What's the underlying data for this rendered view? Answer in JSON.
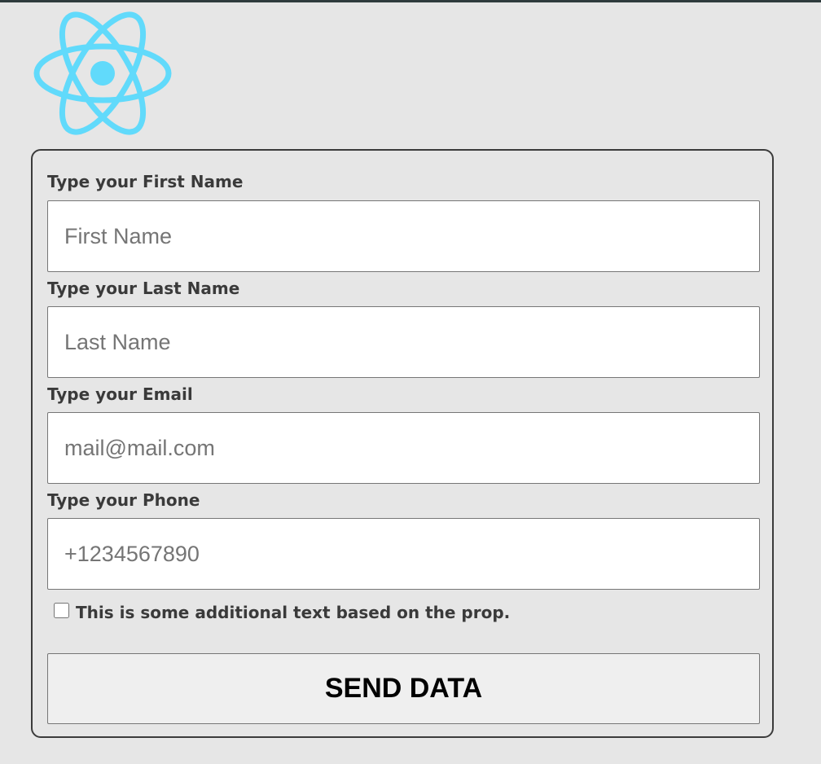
{
  "header": {
    "logo_icon": "react-atom-icon",
    "logo_color": "#61dafb",
    "top_bar_color": "#2f3b3d"
  },
  "form": {
    "first_name": {
      "label": "Type your First Name",
      "placeholder": "First Name",
      "value": ""
    },
    "last_name": {
      "label": "Type your Last Name",
      "placeholder": "Last Name",
      "value": ""
    },
    "email": {
      "label": "Type your Email",
      "placeholder": "mail@mail.com",
      "value": ""
    },
    "phone": {
      "label": "Type your Phone",
      "placeholder": "+1234567890",
      "value": ""
    },
    "checkbox": {
      "label": "This is some additional text based on the prop.",
      "checked": false
    },
    "submit_label": "SEND DATA"
  }
}
